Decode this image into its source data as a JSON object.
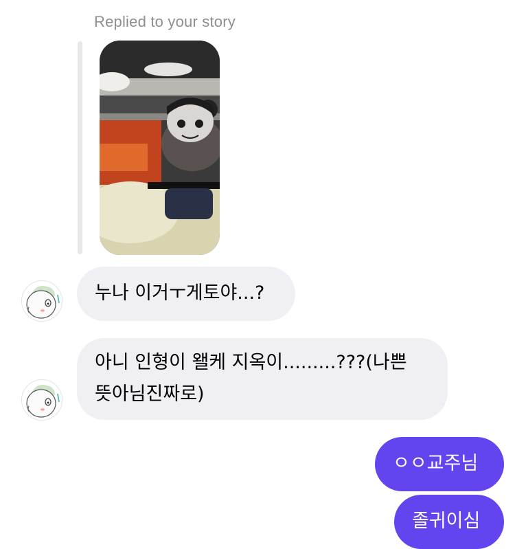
{
  "story": {
    "replied_label": "Replied to your story"
  },
  "messages": [
    {
      "direction": "incoming",
      "text": "누나 이거ㅜ게토야...?",
      "avatar_icon": "cartoon-mascot-avatar"
    },
    {
      "direction": "incoming",
      "text_line1": "아니 인형이 왤케 지옥이.........???(나쁜",
      "text_line2": "뜻아님진짜로)",
      "avatar_icon": "cartoon-mascot-avatar"
    },
    {
      "direction": "outgoing",
      "text": "ㅇㅇ교주님"
    },
    {
      "direction": "outgoing",
      "text": "졸귀이심"
    }
  ],
  "colors": {
    "incoming_bubble": "#efeff4",
    "outgoing_bubble": "#6344ee",
    "label_gray": "#8e8e93"
  }
}
